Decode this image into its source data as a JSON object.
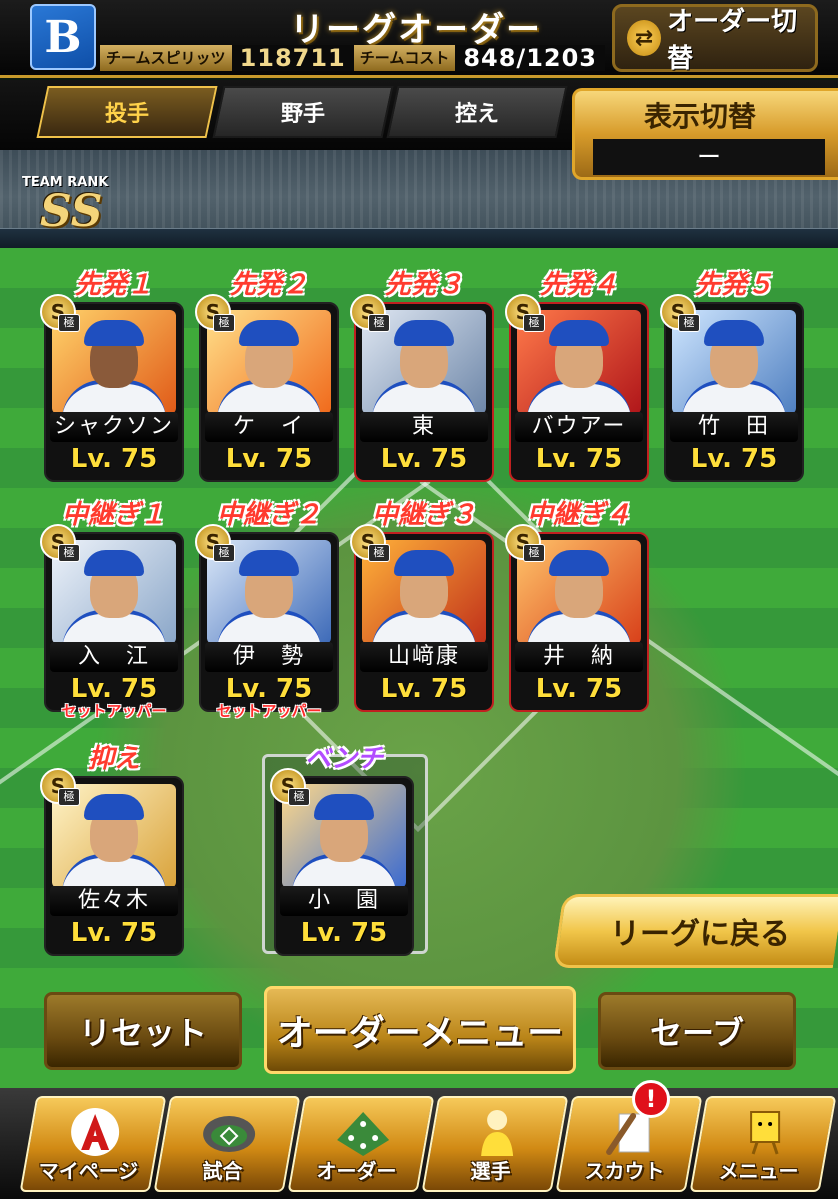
{
  "header": {
    "title": "リーグオーダー",
    "logo": "B",
    "team_spirits_label": "チームスピリッツ",
    "team_spirits_value": "118711",
    "team_cost_label": "チームコスト",
    "team_cost_value": "848/1203",
    "order_switch_label": "オーダー切替"
  },
  "tabs": [
    {
      "label": "投手",
      "active": true
    },
    {
      "label": "野手",
      "active": false
    },
    {
      "label": "控え",
      "active": false
    }
  ],
  "display_switch": {
    "label": "表示切替",
    "value": "ー"
  },
  "team_rank": {
    "label": "TEAM RANK",
    "value": "SS"
  },
  "badge": {
    "rank": "S",
    "sub": "極"
  },
  "starters": [
    {
      "slot": "先発１",
      "name": "シャクソン",
      "level": "Lv. 75"
    },
    {
      "slot": "先発２",
      "name": "ケ　イ",
      "level": "Lv. 75"
    },
    {
      "slot": "先発３",
      "name": "東",
      "level": "Lv. 75"
    },
    {
      "slot": "先発４",
      "name": "バウアー",
      "level": "Lv. 75"
    },
    {
      "slot": "先発５",
      "name": "竹　田",
      "level": "Lv. 75"
    }
  ],
  "relievers": [
    {
      "slot": "中継ぎ１",
      "name": "入　江",
      "level": "Lv. 75",
      "note": "セットアッパー"
    },
    {
      "slot": "中継ぎ２",
      "name": "伊　勢",
      "level": "Lv. 75",
      "note": "セットアッパー"
    },
    {
      "slot": "中継ぎ３",
      "name": "山﨑康",
      "level": "Lv. 75",
      "note": ""
    },
    {
      "slot": "中継ぎ４",
      "name": "井　納",
      "level": "Lv. 75",
      "note": ""
    }
  ],
  "closer": {
    "slot": "抑え",
    "name": "佐々木",
    "level": "Lv. 75"
  },
  "bench": {
    "slot": "ベンチ",
    "name": "小　園",
    "level": "Lv. 75"
  },
  "buttons": {
    "back_to_league": "リーグに戻る",
    "reset": "リセット",
    "order_menu": "オーダーメニュー",
    "save": "セーブ"
  },
  "footer_nav": [
    {
      "label": "マイページ",
      "icon": "mypage-a-icon"
    },
    {
      "label": "試合",
      "icon": "stadium-icon"
    },
    {
      "label": "オーダー",
      "icon": "field-order-icon"
    },
    {
      "label": "選手",
      "icon": "player-icon"
    },
    {
      "label": "スカウト",
      "icon": "scout-bat-icon"
    },
    {
      "label": "メニュー",
      "icon": "menu-character-icon"
    }
  ],
  "scout_alert": "!",
  "colors": {
    "gold": "#f1c64a",
    "slot_label_red": "#ff3b2e",
    "bench_purple": "#b24cff",
    "level_yellow": "#ffde3a",
    "team_blue": "#1f4fbf"
  }
}
